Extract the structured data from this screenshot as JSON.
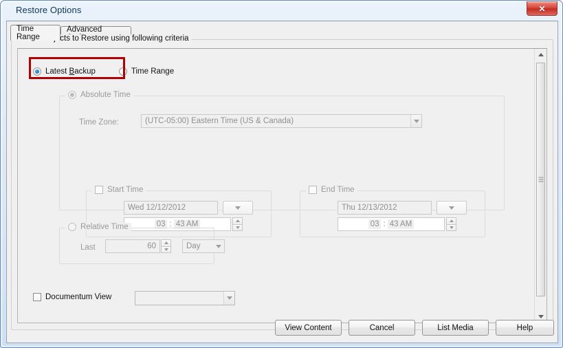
{
  "window": {
    "title": "Restore Options",
    "close_label": "✕"
  },
  "tabs": [
    {
      "label": "Time Range",
      "active": true
    },
    {
      "label": "Advanced Options",
      "active": false
    }
  ],
  "group": {
    "legend": "Show Objects to Restore using following criteria"
  },
  "mode": {
    "latest_backup": "Latest Backup",
    "latest_backup_pre": "Latest ",
    "latest_backup_accel": "B",
    "latest_backup_post": "ackup",
    "time_range": "Time Range",
    "selected": "Latest Backup",
    "highlight_color": "#b00000"
  },
  "absolute_time": {
    "legend": "Absolute Time",
    "time_zone_label": "Time Zone:",
    "time_zone_value": "(UTC-05:00) Eastern Time (US & Canada)",
    "start": {
      "legend": "Start Time",
      "checked": false,
      "date": "Wed 12/12/2012",
      "time_hour": "03",
      "time_sep": ":",
      "time_rest": "43 AM"
    },
    "end": {
      "legend": "End Time",
      "checked": false,
      "date": "Thu 12/13/2012",
      "time_hour": "03",
      "time_sep": ":",
      "time_rest": "43 AM"
    }
  },
  "relative_time": {
    "legend": "Relative Time",
    "last_label": "Last",
    "value": "60",
    "unit": "Day"
  },
  "documentum": {
    "label": "Documentum View",
    "checked": false,
    "value": ""
  },
  "buttons": {
    "view_content": "View Content",
    "cancel": "Cancel",
    "list_media": "List Media",
    "help": "Help"
  },
  "scrollbar": {
    "up": "▲",
    "down": "▼"
  }
}
